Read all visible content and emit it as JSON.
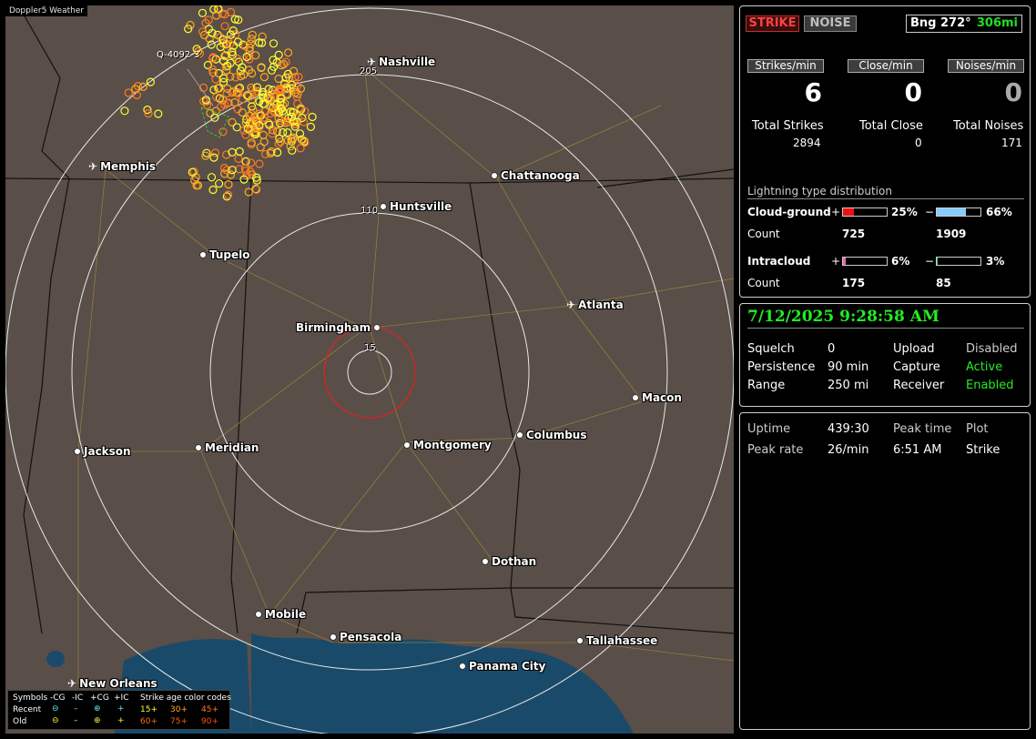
{
  "map": {
    "title": "Doppler5 Weather",
    "cities": [
      {
        "name": "Nashville",
        "type": "airport"
      },
      {
        "name": "Memphis",
        "type": "airport"
      },
      {
        "name": "Chattanooga",
        "type": "city"
      },
      {
        "name": "Huntsville",
        "type": "city"
      },
      {
        "name": "Tupelo",
        "type": "city"
      },
      {
        "name": "Atlanta",
        "type": "airport"
      },
      {
        "name": "Birmingham",
        "type": "city"
      },
      {
        "name": "Macon",
        "type": "city"
      },
      {
        "name": "Columbus",
        "type": "city"
      },
      {
        "name": "Montgomery",
        "type": "city"
      },
      {
        "name": "Jackson",
        "type": "city"
      },
      {
        "name": "Meridian",
        "type": "city"
      },
      {
        "name": "Dothan",
        "type": "city"
      },
      {
        "name": "Mobile",
        "type": "city"
      },
      {
        "name": "Pensacola",
        "type": "city"
      },
      {
        "name": "Tallahassee",
        "type": "city"
      },
      {
        "name": "Panama City",
        "type": "city"
      },
      {
        "name": "New Orleans",
        "type": "airport"
      }
    ],
    "range_rings": [
      "205",
      "110",
      "15"
    ],
    "marker_label": "Q-4092-3",
    "legend": {
      "symbols_label": "Symbols",
      "cols": [
        "-CG",
        "-IC",
        "+CG",
        "+IC"
      ],
      "recent_label": "Recent",
      "old_label": "Old",
      "age_title": "Strike age color codes",
      "ages_recent": [
        "15+",
        "30+",
        "45+"
      ],
      "ages_old": [
        "60+",
        "75+",
        "90+"
      ],
      "age_colors": [
        "#ffff33",
        "#ffaa22",
        "#ff7a22",
        "#ff6a10",
        "#ff5a10",
        "#ff5010"
      ]
    },
    "colors": {
      "land": "#5a4e48",
      "water": "#1a4a6a",
      "state_border": "#111111",
      "roads": "#a08a3a",
      "rings": "#e8e8e8",
      "close_ring": "#dd2222"
    }
  },
  "panel": {
    "strike_btn": "STRIKE",
    "noise_btn": "NOISE",
    "bearing": "Bng 272°",
    "distance": "306mi",
    "rates": [
      {
        "label": "Strikes/min",
        "value": "6"
      },
      {
        "label": "Close/min",
        "value": "0"
      },
      {
        "label": "Noises/min",
        "value": "0"
      }
    ],
    "totals": [
      {
        "label": "Total Strikes",
        "value": "2894"
      },
      {
        "label": "Total Close",
        "value": "0"
      },
      {
        "label": "Total Noises",
        "value": "171"
      }
    ],
    "dist_title": "Lightning type distribution",
    "cg": {
      "label": "Cloud-ground",
      "pos_sign": "+",
      "pos_pct": "25%",
      "pos_frac": 0.25,
      "neg_sign": "−",
      "neg_pct": "66%",
      "neg_frac": 0.66,
      "count_label": "Count",
      "pos_count": "725",
      "neg_count": "1909"
    },
    "ic": {
      "label": "Intracloud",
      "pos_sign": "+",
      "pos_pct": "6%",
      "pos_frac": 0.06,
      "neg_sign": "−",
      "neg_pct": "3%",
      "neg_frac": 0.03,
      "count_label": "Count",
      "pos_count": "175",
      "neg_count": "85"
    },
    "bar_colors": {
      "cg_pos": "#ee1111",
      "cg_neg": "#88ccff",
      "ic_pos": "#ee66aa",
      "ic_neg": "#22dd66"
    }
  },
  "status": {
    "datetime": "7/12/2025 9:28:58 AM",
    "rows": [
      {
        "k1": "Squelch",
        "v1": "0",
        "k2": "Upload",
        "v2": "Disabled"
      },
      {
        "k1": "Persistence",
        "v1": "90 min",
        "k2": "Capture",
        "v2": "Active"
      },
      {
        "k1": "Range",
        "v1": "250 mi",
        "k2": "Receiver",
        "v2": "Enabled"
      }
    ]
  },
  "stats": {
    "uptime_label": "Uptime",
    "uptime": "439:30",
    "peak_time_label": "Peak time",
    "plot_label": "Plot",
    "peak_rate_label": "Peak rate",
    "peak_rate": "26/min",
    "peak_time": "6:51 AM",
    "plot": "Strike"
  }
}
